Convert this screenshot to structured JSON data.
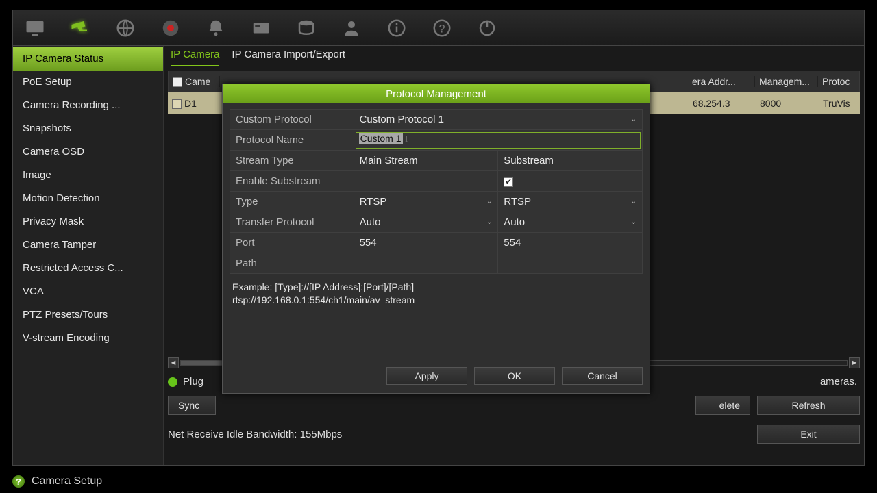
{
  "topbar": {
    "icons": [
      "monitor-icon",
      "camera-icon",
      "network-icon",
      "record-icon",
      "alarm-icon",
      "settings-icon",
      "hdd-icon",
      "user-icon",
      "info-icon",
      "help-icon",
      "power-icon"
    ]
  },
  "sidebar": {
    "items": [
      "IP Camera Status",
      "PoE Setup",
      "Camera Recording ...",
      "Snapshots",
      "Camera OSD",
      "Image",
      "Motion Detection",
      "Privacy Mask",
      "Camera Tamper",
      "Restricted Access C...",
      "VCA",
      "PTZ Presets/Tours",
      "V-stream Encoding"
    ],
    "selected": 0
  },
  "tabs": {
    "items": [
      "IP Camera",
      "IP Camera Import/Export"
    ],
    "active": 0
  },
  "tableHead": {
    "col0": "Came",
    "colAddr": "era Addr...",
    "colMgmt": "Managem...",
    "colProto": "Protoc"
  },
  "row0": {
    "chan": "D1",
    "addr": "68.254.3",
    "mgmt": "8000",
    "proto": "TruVis"
  },
  "statusLine": {
    "leftFrag": "Plug",
    "rightFrag": "ameras."
  },
  "bottomButtons": {
    "sync": "Sync",
    "delete": "elete",
    "refresh": "Refresh",
    "exit": "Exit"
  },
  "bandwidth": "Net Receive Idle Bandwidth: 155Mbps",
  "statusbar": "Camera Setup",
  "modal": {
    "title": "Protocol Management",
    "rows": {
      "customProtocol": {
        "label": "Custom Protocol",
        "value": "Custom Protocol 1"
      },
      "protocolName": {
        "label": "Protocol Name",
        "value": "Custom 1"
      },
      "streamType": {
        "label": "Stream Type",
        "a": "Main Stream",
        "b": "Substream"
      },
      "enableSub": {
        "label": "Enable Substream",
        "checked": true
      },
      "type": {
        "label": "Type",
        "a": "RTSP",
        "b": "RTSP"
      },
      "transfer": {
        "label": "Transfer Protocol",
        "a": "Auto",
        "b": "Auto"
      },
      "port": {
        "label": "Port",
        "a": "554",
        "b": "554"
      },
      "path": {
        "label": "Path",
        "a": "",
        "b": ""
      }
    },
    "exampleLine1": "Example: [Type]://[IP Address]:[Port]/[Path]",
    "exampleLine2": "rtsp://192.168.0.1:554/ch1/main/av_stream",
    "buttons": {
      "apply": "Apply",
      "ok": "OK",
      "cancel": "Cancel"
    }
  }
}
